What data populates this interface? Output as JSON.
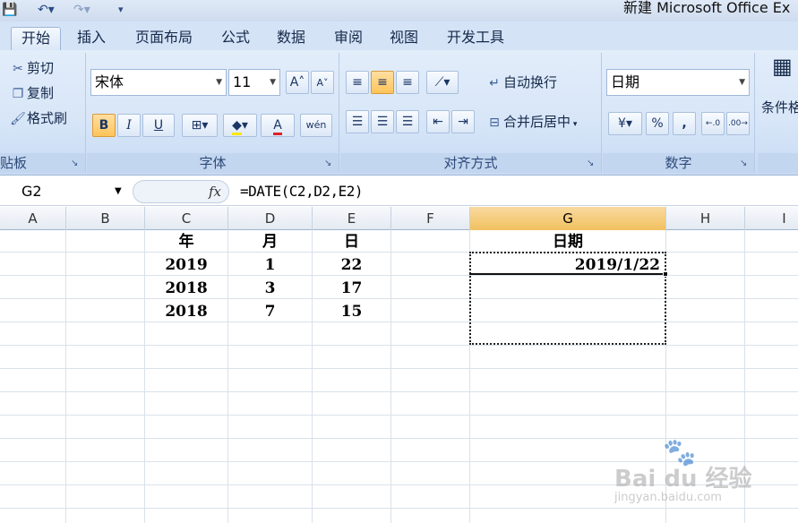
{
  "window": {
    "title": "新建 Microsoft Office Ex"
  },
  "quick_access": {
    "save_icon": "save-icon",
    "undo_icon": "undo-icon",
    "redo_icon": "redo-icon",
    "customize_icon": "customize-qat-icon"
  },
  "tabs": [
    {
      "label": "开始",
      "active": true
    },
    {
      "label": "插入"
    },
    {
      "label": "页面布局"
    },
    {
      "label": "公式"
    },
    {
      "label": "数据"
    },
    {
      "label": "审阅"
    },
    {
      "label": "视图"
    },
    {
      "label": "开发工具"
    }
  ],
  "ribbon": {
    "clipboard": {
      "label": "贴板",
      "cut": "剪切",
      "copy": "复制",
      "format_painter": "格式刷"
    },
    "font": {
      "label": "字体",
      "font_name": "宋体",
      "font_size": "11",
      "bold": "B",
      "italic": "I",
      "underline": "U",
      "font_color_letter": "A",
      "phonetic": "wén"
    },
    "alignment": {
      "label": "对齐方式",
      "wrap_text": "自动换行",
      "merge_center": "合并后居中"
    },
    "number": {
      "label": "数字",
      "format": "日期",
      "percent": "%",
      "comma": ","
    },
    "styles": {
      "conditional": "条件格"
    }
  },
  "formula_bar": {
    "name_box": "G2",
    "fx": "fx",
    "formula": "=DATE(C2,D2,E2)"
  },
  "columns": [
    "A",
    "B",
    "C",
    "D",
    "E",
    "F",
    "G",
    "H",
    "I"
  ],
  "selected_column": "G",
  "cells": {
    "C1": "年",
    "D1": "月",
    "E1": "日",
    "G1": "日期",
    "C2": "2019",
    "D2": "1",
    "E2": "22",
    "G2": "2019/1/22",
    "C3": "2018",
    "D3": "3",
    "E3": "17",
    "C4": "2018",
    "D4": "7",
    "E4": "15"
  },
  "watermark": {
    "brand": "Bai du 经验",
    "url": "jingyan.baidu.com"
  }
}
